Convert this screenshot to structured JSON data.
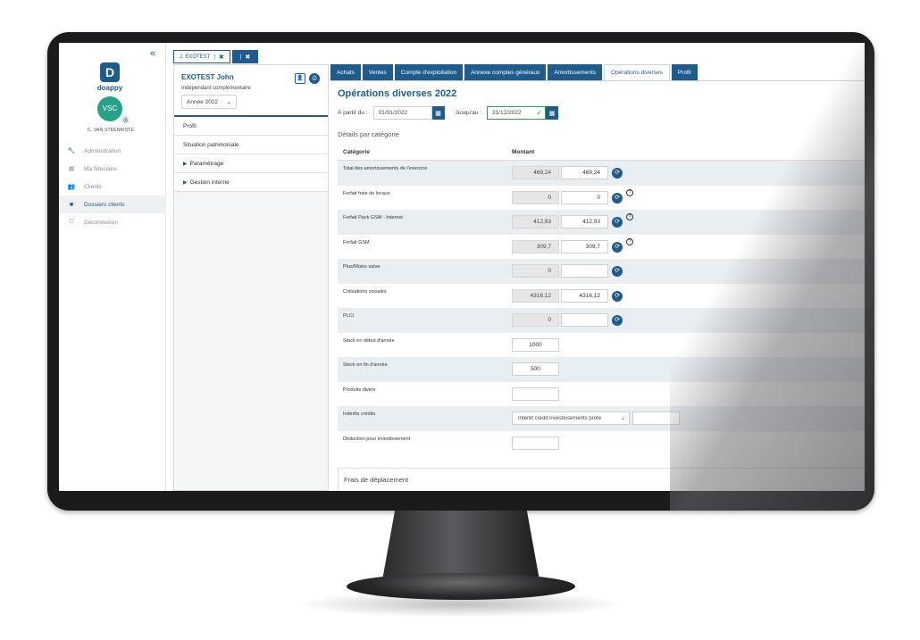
{
  "sidebar": {
    "collapse_icon": "«",
    "logo_letter": "D",
    "logo_text": "doappy",
    "avatar_initials": "VSC",
    "user_name": "C. VAN STEENKISTE",
    "nav": [
      {
        "label": "Administration",
        "icon": "wrench-icon"
      },
      {
        "label": "Ma fiduciaire",
        "icon": "building-icon"
      },
      {
        "label": "Clients",
        "icon": "users-icon"
      },
      {
        "label": "Dossiers clients",
        "icon": "folder-icon",
        "active": true
      },
      {
        "label": "Déconnexion",
        "icon": "power-icon"
      }
    ]
  },
  "file_tabs": [
    {
      "label": "J. EXOTEST"
    },
    {
      "label": ""
    }
  ],
  "client": {
    "name": "EXOTEST John",
    "type": "Indépendant complémentaire",
    "year": "Année 2022",
    "menu": [
      {
        "label": "Profil",
        "caret": false
      },
      {
        "label": "Situation patrimoniale",
        "caret": false
      },
      {
        "label": "Paramétrage",
        "caret": true
      },
      {
        "label": "Gestion interne",
        "caret": true
      }
    ]
  },
  "tabs": [
    {
      "label": "Achats"
    },
    {
      "label": "Ventes"
    },
    {
      "label": "Compte d'exploitation"
    },
    {
      "label": "Annexe comptes généraux"
    },
    {
      "label": "Amortissements"
    },
    {
      "label": "Opérations diverses",
      "active": true
    },
    {
      "label": "Profil"
    }
  ],
  "main": {
    "title": "Opérations diverses 2022",
    "from_label": "À partir du :",
    "from_value": "01/01/2022",
    "to_label": "Jusqu'au :",
    "to_value": "31/12/2022",
    "section": "Détails par catégorie",
    "col_category": "Catégorie",
    "col_amount": "Montant",
    "rows": [
      {
        "label": "Total des amortissements de l'exercice",
        "readonly": "469,24",
        "value": "469,24",
        "refresh": true,
        "help": false
      },
      {
        "label": "Forfait frais de locaux",
        "readonly": "0",
        "value": "0",
        "refresh": true,
        "help": true
      },
      {
        "label": "Forfait Pack GSM - Internet",
        "readonly": "412,93",
        "value": "412,93",
        "refresh": true,
        "help": true
      },
      {
        "label": "Forfait GSM",
        "readonly": "309,7",
        "value": "309,7",
        "refresh": true,
        "help": true
      },
      {
        "label": "Plus/Moins value",
        "readonly": "0",
        "value": "",
        "refresh": true,
        "help": false
      },
      {
        "label": "Cotisations sociales",
        "readonly": "4316,12",
        "value": "4316,12",
        "refresh": true,
        "help": false
      },
      {
        "label": "PLCI",
        "readonly": "0",
        "value": "",
        "refresh": true,
        "help": false
      },
      {
        "label": "Stock en début d'année",
        "value": "1000"
      },
      {
        "label": "Stock en fin d'année",
        "value": "500"
      },
      {
        "label": "Produits divers",
        "value": ""
      },
      {
        "label": "Intérêts crédits",
        "select": "Intérêt crédit investissements profe",
        "value": ""
      },
      {
        "label": "Déduction pour investissement",
        "value": ""
      }
    ],
    "frais_title": "Frais de déplacement"
  },
  "colors": {
    "primary": "#1f5c8c",
    "accent": "#27a18a",
    "row_alt": "#e9eef3"
  }
}
